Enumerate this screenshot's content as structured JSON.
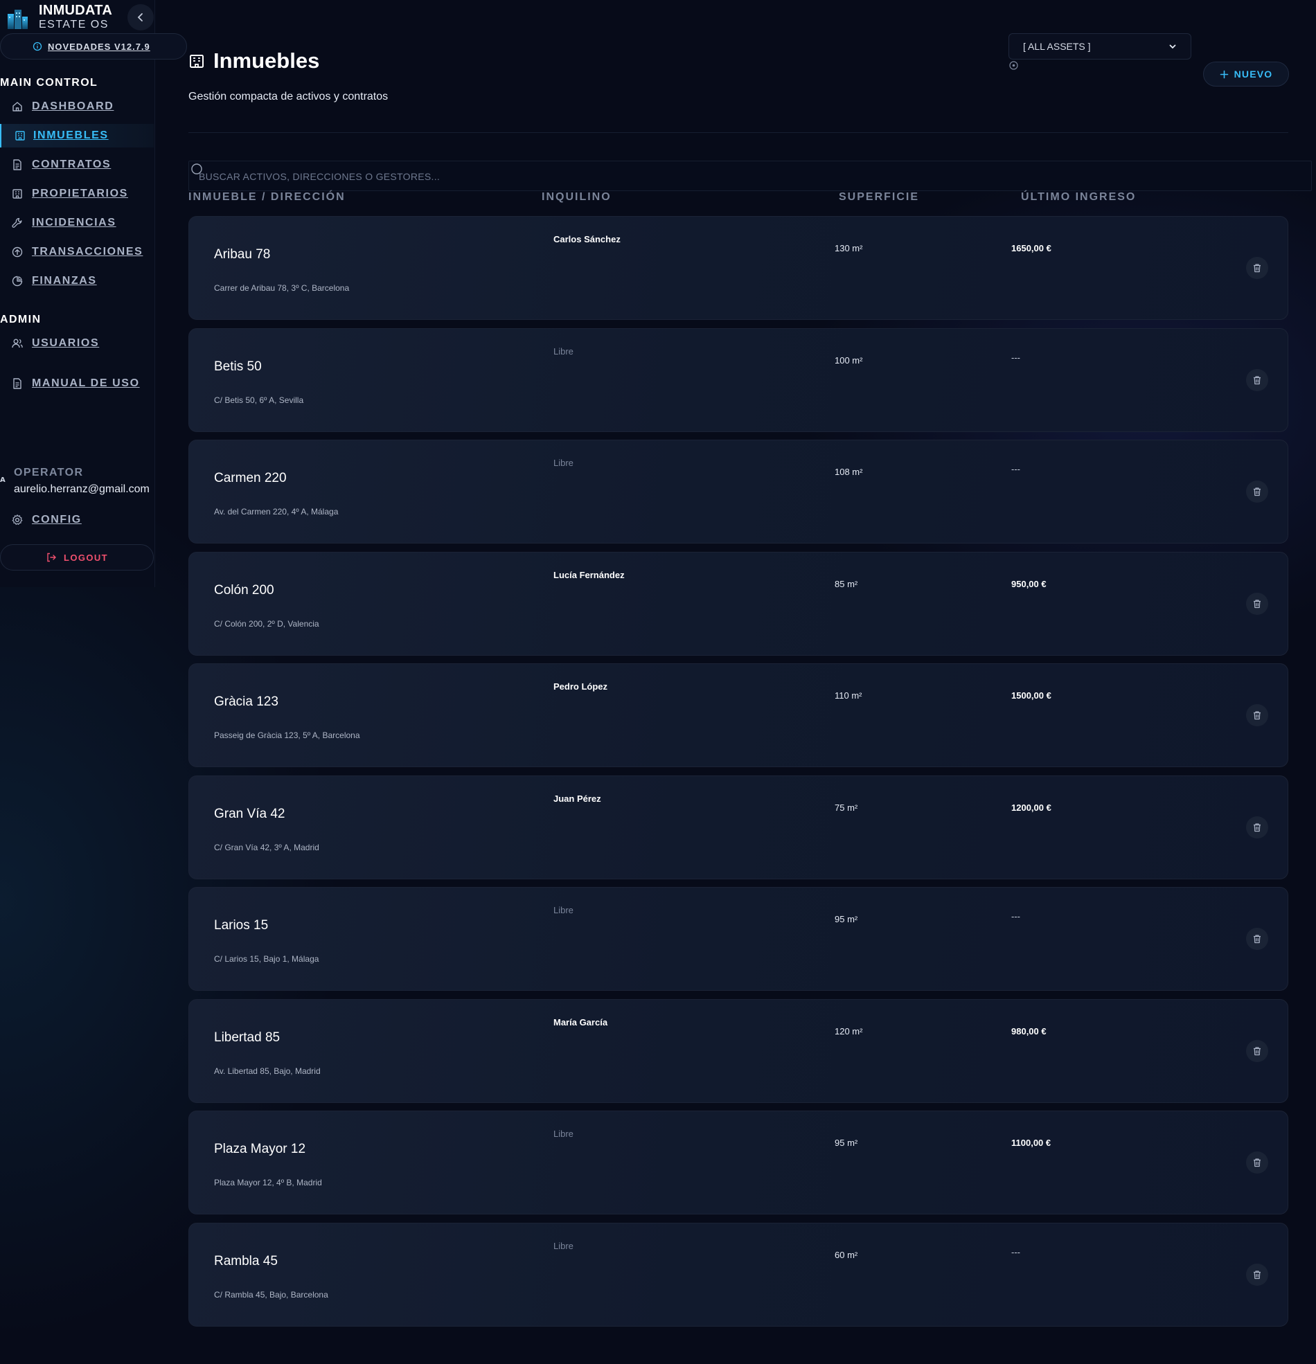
{
  "app": {
    "brand_title": "INMUDATA",
    "brand_subtitle": "ESTATE OS",
    "news_label": "NOVEDADES V12.7.9"
  },
  "sidebar": {
    "main_section": "MAIN CONTROL",
    "main_items": [
      {
        "label": "DASHBOARD",
        "icon": "home-icon"
      },
      {
        "label": "INMUEBLES",
        "icon": "building-icon",
        "active": true
      },
      {
        "label": "CONTRATOS",
        "icon": "document-icon"
      },
      {
        "label": "PROPIETARIOS",
        "icon": "building-icon"
      },
      {
        "label": "INCIDENCIAS",
        "icon": "wrench-icon"
      },
      {
        "label": "TRANSACCIONES",
        "icon": "arrow-circle-icon"
      },
      {
        "label": "FINANZAS",
        "icon": "pie-chart-icon"
      }
    ],
    "admin_section": "ADMIN",
    "admin_items": [
      {
        "label": "USUARIOS",
        "icon": "users-icon"
      },
      {
        "label": "MANUAL DE USO",
        "icon": "document-icon"
      }
    ],
    "operator_initial": "A",
    "operator_label": "OPERATOR",
    "operator_email": "aurelio.herranz@gmail.com",
    "config_label": "CONFIG",
    "logout_label": "LOGOUT"
  },
  "main": {
    "title": "Inmuebles",
    "subtitle": "Gestión compacta de activos y contratos",
    "asset_filter": "[ ALL ASSETS ]",
    "new_button": "NUEVO",
    "search_placeholder": "BUSCAR ACTIVOS, DIRECCIONES O GESTORES...",
    "columns": [
      "INMUEBLE / DIRECCIÓN",
      "INQUILINO",
      "SUPERFICIE",
      "ÚLTIMO INGRESO"
    ]
  },
  "properties": [
    {
      "name": "Aribau 78",
      "address": "Carrer de Aribau 78, 3º C, Barcelona",
      "tenant": "Carlos Sánchez",
      "area": "130 m²",
      "income": "1650,00 €"
    },
    {
      "name": "Betis 50",
      "address": "C/ Betis 50, 6º A, Sevilla",
      "tenant": "Libre",
      "area": "100 m²",
      "income": "---"
    },
    {
      "name": "Carmen 220",
      "address": "Av. del Carmen 220, 4º A, Málaga",
      "tenant": "Libre",
      "area": "108 m²",
      "income": "---"
    },
    {
      "name": "Colón 200",
      "address": "C/ Colón 200, 2º D, Valencia",
      "tenant": "Lucía Fernández",
      "area": "85 m²",
      "income": "950,00 €"
    },
    {
      "name": "Gràcia 123",
      "address": "Passeig de Gràcia 123, 5º A, Barcelona",
      "tenant": "Pedro López",
      "area": "110 m²",
      "income": "1500,00 €"
    },
    {
      "name": "Gran Vía 42",
      "address": "C/ Gran Vía 42, 3º A, Madrid",
      "tenant": "Juan Pérez",
      "area": "75 m²",
      "income": "1200,00 €"
    },
    {
      "name": "Larios 15",
      "address": "C/ Larios 15, Bajo 1, Málaga",
      "tenant": "Libre",
      "area": "95 m²",
      "income": "---"
    },
    {
      "name": "Libertad 85",
      "address": "Av. Libertad 85, Bajo, Madrid",
      "tenant": "María García",
      "area": "120 m²",
      "income": "980,00 €"
    },
    {
      "name": "Plaza Mayor 12",
      "address": "Plaza Mayor 12, 4º B, Madrid",
      "tenant": "Libre",
      "area": "95 m²",
      "income": "1100,00 €"
    },
    {
      "name": "Rambla 45",
      "address": "C/ Rambla 45, Bajo, Barcelona",
      "tenant": "Libre",
      "area": "60 m²",
      "income": "---"
    }
  ],
  "colors": {
    "accent": "#38bdf8",
    "danger": "#f0506e",
    "background": "#070b19"
  }
}
